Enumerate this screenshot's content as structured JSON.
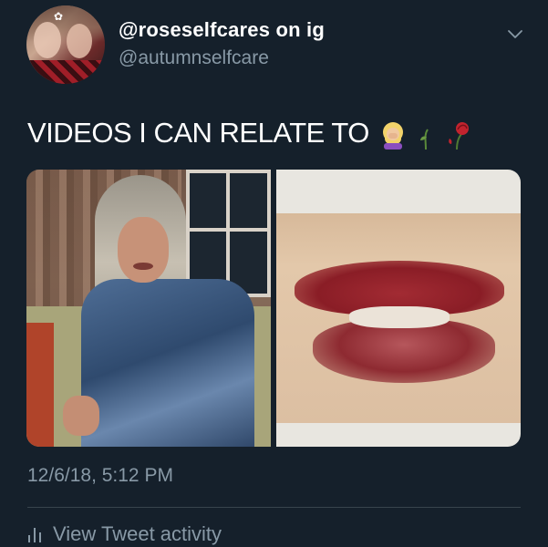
{
  "tweet": {
    "display_name": "@roseselfcares on ig",
    "handle": "@autumnselfcare",
    "text": "VIDEOS I CAN RELATE TO",
    "emojis": [
      "woman-facepalming-emoji",
      "wilted-flower-emoji",
      "wilted-rose-emoji"
    ],
    "timestamp": "12/6/18, 5:12 PM",
    "activity_label": "View Tweet activity"
  },
  "colors": {
    "background": "#15202b",
    "primary_text": "#ffffff",
    "secondary_text": "#8899a6",
    "divider": "#38444d"
  },
  "icons": {
    "menu": "chevron-down-icon",
    "activity": "bar-chart-icon"
  },
  "media": {
    "count": 2
  }
}
